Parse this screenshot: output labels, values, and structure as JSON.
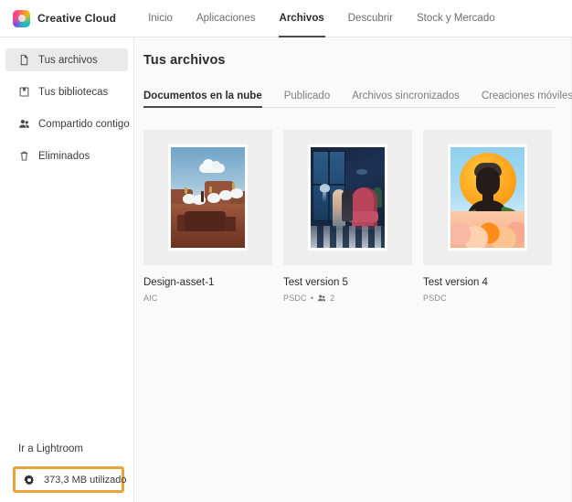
{
  "topnav": {
    "brand": "Creative Cloud",
    "logo_icon": "creative-cloud-logo-icon",
    "items": [
      {
        "label": "Inicio",
        "active": false
      },
      {
        "label": "Aplicaciones",
        "active": false
      },
      {
        "label": "Archivos",
        "active": true
      },
      {
        "label": "Descubrir",
        "active": false
      },
      {
        "label": "Stock y Mercado",
        "active": false
      }
    ]
  },
  "sidebar": {
    "items": [
      {
        "label": "Tus archivos",
        "icon": "document-icon",
        "active": true
      },
      {
        "label": "Tus bibliotecas",
        "icon": "library-icon",
        "active": false
      },
      {
        "label": "Compartido contigo",
        "icon": "people-icon",
        "active": false
      },
      {
        "label": "Eliminados",
        "icon": "trash-icon",
        "active": false
      }
    ],
    "lightroom_link": "Ir a Lightroom",
    "storage": {
      "icon": "gear-icon",
      "label": "373,3 MB utilizado",
      "highlight_color": "#E8A33D"
    }
  },
  "main": {
    "title": "Tus archivos",
    "tabs": [
      {
        "label": "Documentos en la nube",
        "active": true
      },
      {
        "label": "Publicado",
        "active": false
      },
      {
        "label": "Archivos sincronizados",
        "active": false
      },
      {
        "label": "Creaciones móviles",
        "active": false
      }
    ],
    "cards": [
      {
        "name": "Design-asset-1",
        "type": "AIC",
        "shared_count": null,
        "art": "desert-mesa-thumbnail"
      },
      {
        "name": "Test version 5",
        "type": "PSDC",
        "shared_count": "2",
        "art": "underwater-room-thumbnail"
      },
      {
        "name": "Test version 4",
        "type": "PSDC",
        "shared_count": null,
        "art": "sun-portrait-thumbnail"
      }
    ],
    "separator_dot": "•"
  }
}
